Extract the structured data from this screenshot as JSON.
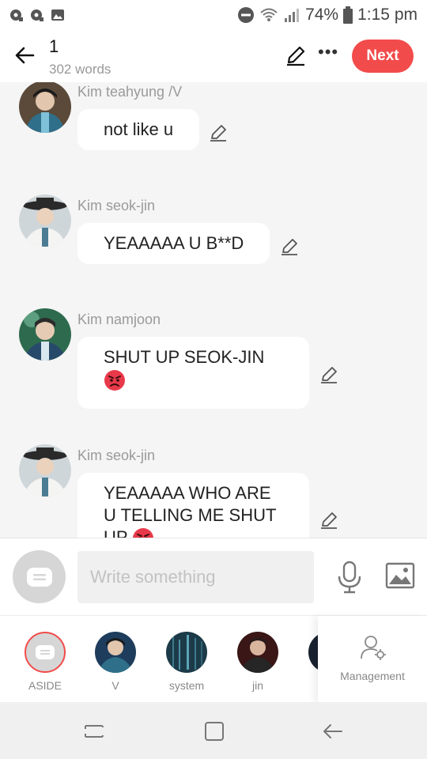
{
  "status_bar": {
    "battery": "74%",
    "time": "1:15 pm"
  },
  "header": {
    "title": "1",
    "word_count": "302 words",
    "next_label": "Next"
  },
  "messages": [
    {
      "name": "Kim teahyung /V",
      "text": "not like u",
      "emoji": ""
    },
    {
      "name": "Kim seok-jin",
      "text": "YEAAAAA U B**D",
      "emoji": ""
    },
    {
      "name": "Kim namjoon",
      "text": "SHUT UP SEOK-JIN",
      "emoji": "angry-face"
    },
    {
      "name": "Kim seok-jin",
      "text": "YEAAAAA WHO ARE U TELLING ME SHUT UP",
      "emoji": "angry-face"
    }
  ],
  "composer": {
    "placeholder": "Write something"
  },
  "characters": [
    {
      "label": "ASIDE"
    },
    {
      "label": "V"
    },
    {
      "label": "system"
    },
    {
      "label": "jin"
    },
    {
      "label": ""
    }
  ],
  "management_label": "Management",
  "colors": {
    "accent": "#f24b4b",
    "bubble": "#ffffff",
    "background": "#f5f5f5"
  }
}
